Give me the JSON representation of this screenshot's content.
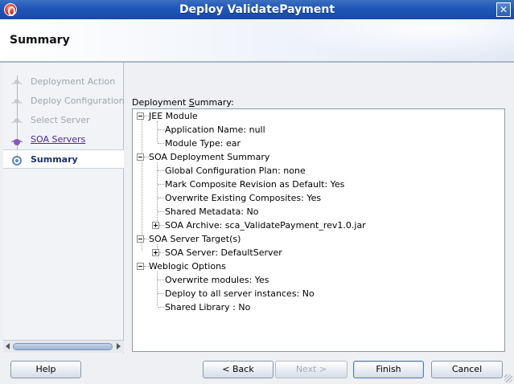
{
  "window": {
    "title": "Deploy ValidatePayment"
  },
  "header": {
    "title": "Summary"
  },
  "nav": {
    "items": [
      {
        "label": "Deployment Action",
        "state": "disabled"
      },
      {
        "label": "Deploy Configuration",
        "state": "disabled"
      },
      {
        "label": "Select Server",
        "state": "disabled"
      },
      {
        "label": "SOA Servers",
        "state": "link"
      },
      {
        "label": "Summary",
        "state": "current"
      }
    ]
  },
  "main": {
    "summary_label_prefix": "Deployment ",
    "summary_label_mnemonic": "S",
    "summary_label_suffix": "ummary:",
    "tree": [
      {
        "label": "JEE Module",
        "level": 0,
        "expander": "minus"
      },
      {
        "label": "Application Name: null",
        "level": 1,
        "expander": "none"
      },
      {
        "label": "Module Type: ear",
        "level": 1,
        "expander": "none"
      },
      {
        "label": "SOA Deployment Summary",
        "level": 0,
        "expander": "minus"
      },
      {
        "label": "Global Configuration Plan: none",
        "level": 1,
        "expander": "none"
      },
      {
        "label": "Mark Composite Revision as Default: Yes",
        "level": 1,
        "expander": "none"
      },
      {
        "label": "Overwrite Existing Composites: Yes",
        "level": 1,
        "expander": "none"
      },
      {
        "label": "Shared Metadata: No",
        "level": 1,
        "expander": "none"
      },
      {
        "label": "SOA Archive: sca_ValidatePayment_rev1.0.jar",
        "level": 1,
        "expander": "plus"
      },
      {
        "label": "SOA Server Target(s)",
        "level": 0,
        "expander": "minus"
      },
      {
        "label": "SOA Server: DefaultServer",
        "level": 1,
        "expander": "plus"
      },
      {
        "label": "Weblogic Options",
        "level": 0,
        "expander": "minus"
      },
      {
        "label": "Overwrite modules: Yes",
        "level": 1,
        "expander": "none"
      },
      {
        "label": "Deploy to all server instances: No",
        "level": 1,
        "expander": "none"
      },
      {
        "label": "Shared Library : No",
        "level": 1,
        "expander": "none"
      }
    ]
  },
  "buttons": {
    "help": "Help",
    "back": "< Back",
    "next": "Next >",
    "finish": "Finish",
    "cancel": "Cancel"
  },
  "icons": {
    "app": "oracle-logo-icon",
    "close": "close-icon",
    "step_done": "step-figure-icon",
    "step_current": "current-step-icon"
  },
  "colors": {
    "titlebar": "#1f56b8",
    "link": "#4b2a8a",
    "current_step": "#1a2f6a"
  }
}
